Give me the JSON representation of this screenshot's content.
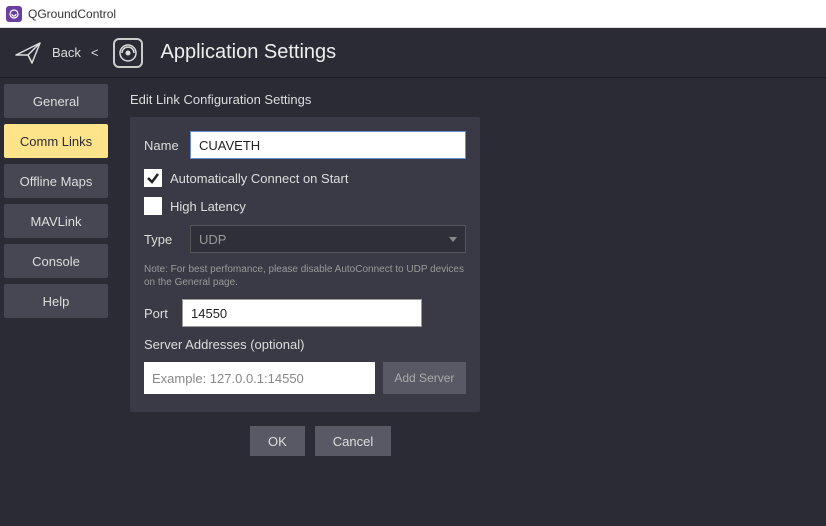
{
  "titlebar": {
    "app_name": "QGroundControl"
  },
  "header": {
    "back": "Back",
    "title": "Application Settings"
  },
  "sidebar": {
    "items": [
      {
        "label": "General"
      },
      {
        "label": "Comm Links"
      },
      {
        "label": "Offline Maps"
      },
      {
        "label": "MAVLink"
      },
      {
        "label": "Console"
      },
      {
        "label": "Help"
      }
    ],
    "active_index": 1
  },
  "edit_link": {
    "section_title": "Edit Link Configuration Settings",
    "name_label": "Name",
    "name_value": "CUAVETH",
    "auto_connect_label": "Automatically Connect on Start",
    "auto_connect_checked": true,
    "high_latency_label": "High Latency",
    "high_latency_checked": false,
    "type_label": "Type",
    "type_value": "UDP",
    "note": "Note: For best perfomance, please disable AutoConnect to UDP devices on the General page.",
    "port_label": "Port",
    "port_value": "14550",
    "server_addresses_label": "Server Addresses (optional)",
    "server_placeholder": "Example: 127.0.0.1:14550",
    "add_server_label": "Add Server",
    "ok_label": "OK",
    "cancel_label": "Cancel"
  }
}
